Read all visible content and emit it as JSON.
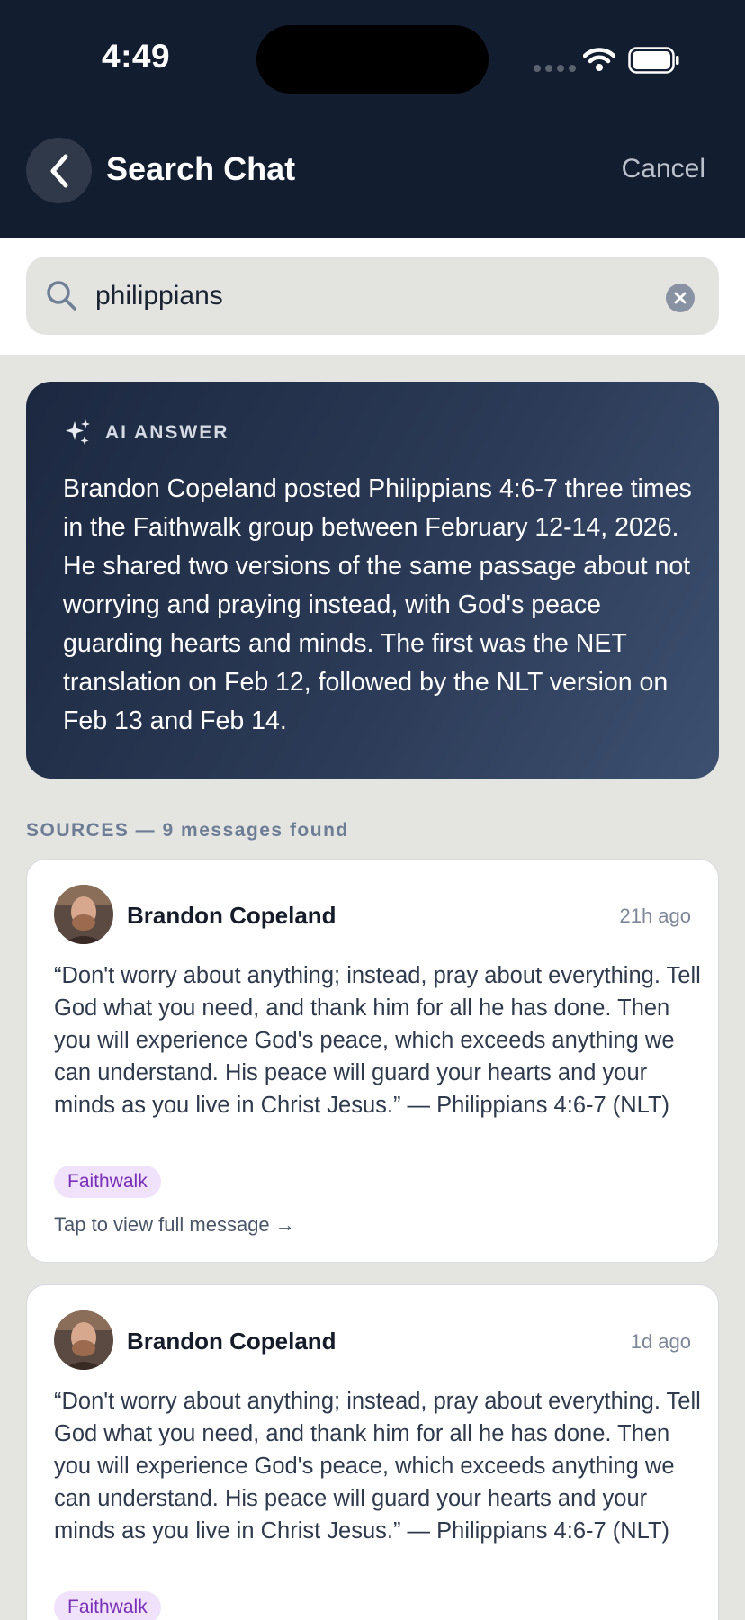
{
  "status_bar": {
    "time": "4:49"
  },
  "header": {
    "title": "Search Chat",
    "cancel_label": "Cancel"
  },
  "search": {
    "value": "philippians",
    "placeholder": "Search"
  },
  "ai_answer": {
    "label": "AI ANSWER",
    "text": "Brandon Copeland posted Philippians 4:6-7 three times in the Faithwalk group between February 12-14, 2026. He shared two versions of the same passage about not worrying and praying instead, with God's peace guarding hearts and minds. The first was the NET translation on Feb 12, followed by the NLT version on Feb 13 and Feb 14."
  },
  "sources_header": "SOURCES — 9 messages found",
  "results": [
    {
      "author": "Brandon Copeland",
      "time": "21h ago",
      "text": "“Don't worry about anything; instead, pray about everything. Tell God what you need, and thank him for all he has done. Then you will experience God's peace, which exceeds anything we can understand. His peace will guard your hearts and your minds as you live in Christ Jesus.” — Philippians 4:6-7 (NLT)",
      "group": "Faithwalk",
      "link": "Tap to view full message →"
    },
    {
      "author": "Brandon Copeland",
      "time": "1d ago",
      "text": "“Don't worry about anything; instead, pray about everything. Tell God what you need, and thank him for all he has done. Then you will experience God's peace, which exceeds anything we can understand. His peace will guard your hearts and your minds as you live in Christ Jesus.” — Philippians 4:6-7 (NLT)",
      "group": "Faithwalk"
    }
  ],
  "colors": {
    "header_bg": "#131d30",
    "tag_bg": "#efe2fa",
    "tag_text": "#7a2fb8"
  }
}
